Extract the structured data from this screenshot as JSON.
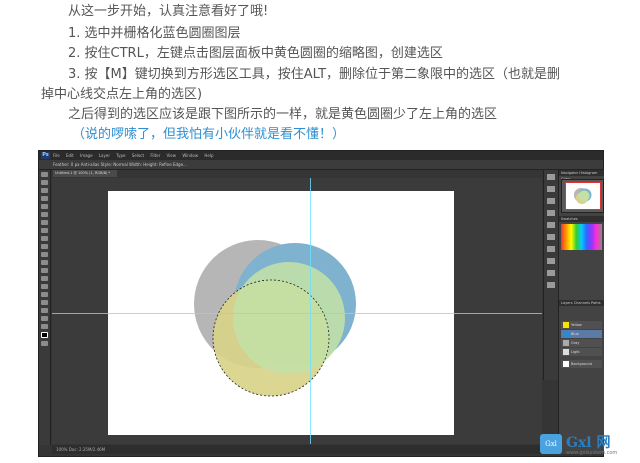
{
  "instructions": {
    "line1": "从这一步开始，认真注意看好了哦!",
    "line2": "1. 选中并栅格化蓝色圆圈图层",
    "line3": "2. 按住CTRL，左键点击图层面板中黄色圆圈的缩略图，创建选区",
    "line4a": "3. 按【M】键切换到方形选区工具，按住ALT，删除位于第二象限中的选区（也就是删",
    "line4b": "掉中心线交点左上角的选区)",
    "line5": "之后得到的选区应该是跟下图所示的一样，就是黄色圆圈少了左上角的选区",
    "line6": "（说的啰嗦了，但我怕有小伙伴就是看不懂！）"
  },
  "photoshop": {
    "logo": "Ps",
    "menus": [
      "File",
      "Edit",
      "Image",
      "Layer",
      "Type",
      "Select",
      "Filter",
      "View",
      "Window",
      "Help"
    ],
    "options": "Feather: 0 px    Anti-alias    Style: Normal    Width:    Height:    Refine Edge...",
    "doc_tab": "Untitled-1 @ 100% (1, RGB/8) *",
    "status": "100%    Doc: 2.25M/2.46M",
    "panels": {
      "navigator": "Navigator  Histogram  Color",
      "swatches": "Swatches",
      "layers": "Layers  Channels  Paths",
      "layer_items": [
        "Yellow",
        "Blue",
        "Gray",
        "Light",
        "Background"
      ]
    },
    "colors": {
      "gray_circle": "#b6b6b6",
      "blue_circle": "#7fb2cf",
      "yellow_circle": "#d9d28a",
      "green_circle": "#c3e0a6",
      "guides": "#6ee0ff"
    }
  },
  "watermark": {
    "logo": "Gxl",
    "text": "Gxl 网",
    "url": "www.gxlsystem.com"
  }
}
